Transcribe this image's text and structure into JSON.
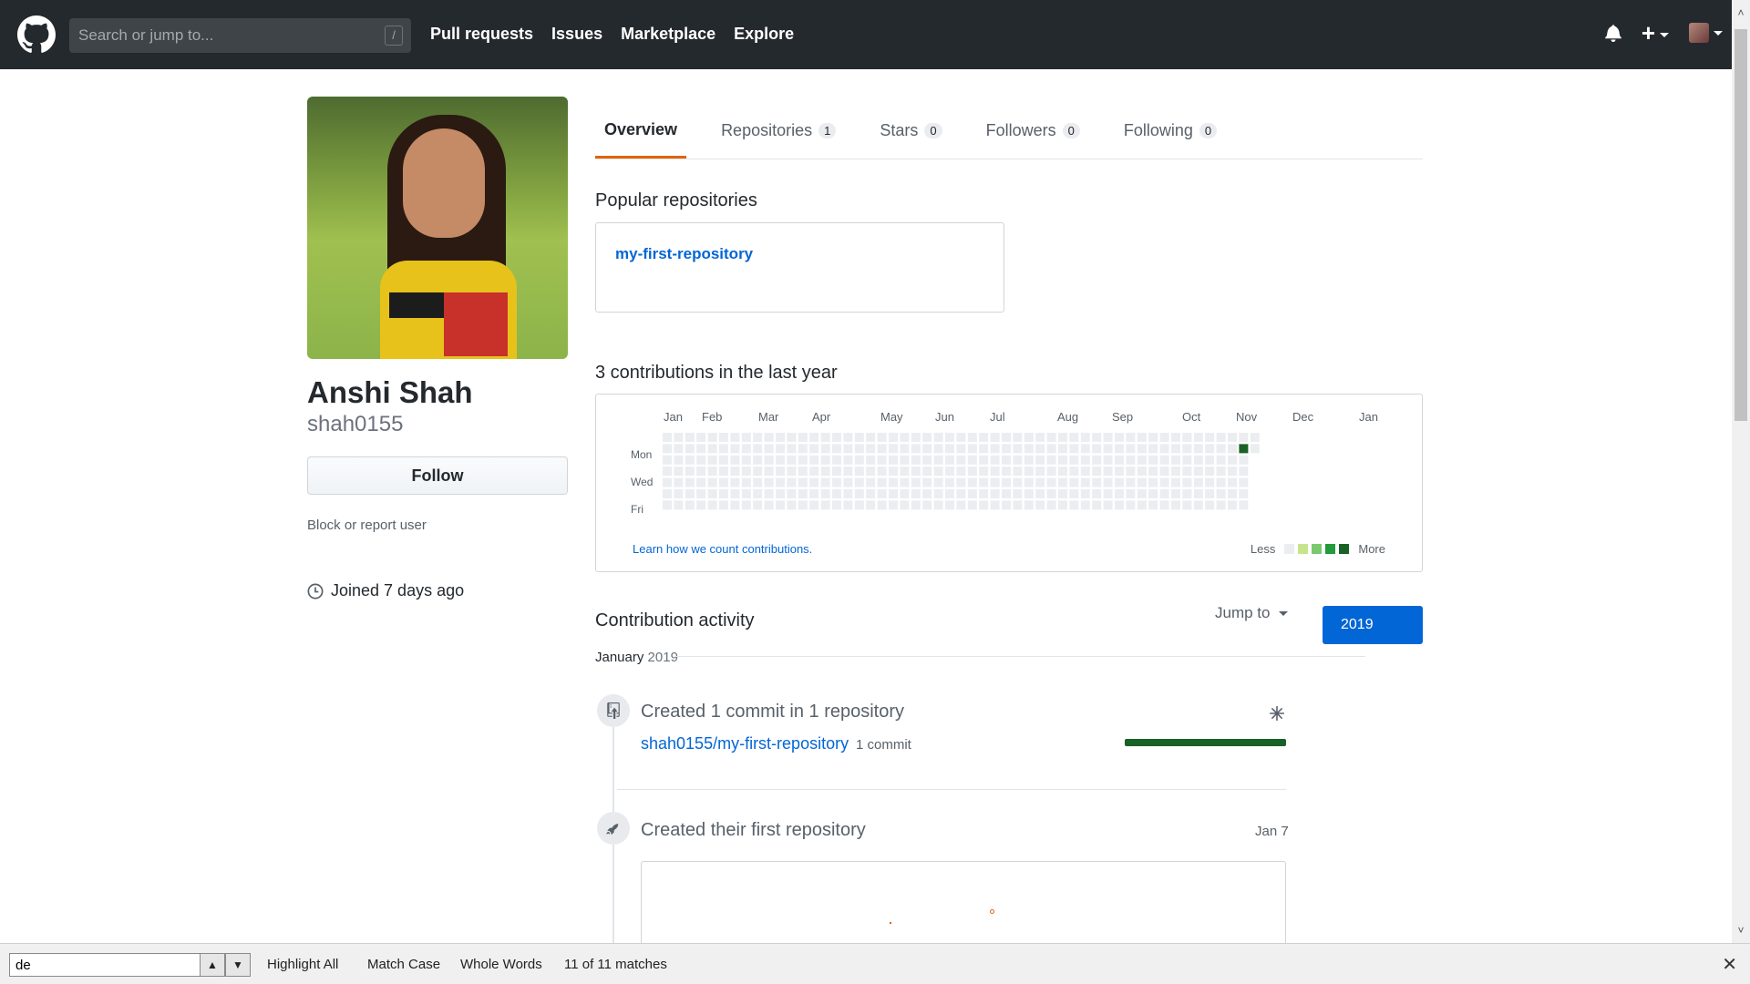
{
  "header": {
    "search_placeholder": "Search or jump to...",
    "slash": "/",
    "nav": [
      "Pull requests",
      "Issues",
      "Marketplace",
      "Explore"
    ]
  },
  "profile": {
    "name": "Anshi Shah",
    "login": "shah0155",
    "follow_label": "Follow",
    "block_label": "Block or report user",
    "joined": "Joined 7 days ago"
  },
  "tabs": [
    {
      "label": "Overview",
      "count": null,
      "active": true
    },
    {
      "label": "Repositories",
      "count": "1",
      "active": false
    },
    {
      "label": "Stars",
      "count": "0",
      "active": false
    },
    {
      "label": "Followers",
      "count": "0",
      "active": false
    },
    {
      "label": "Following",
      "count": "0",
      "active": false
    }
  ],
  "popular": {
    "title": "Popular repositories",
    "repo": "my-first-repository"
  },
  "contributions": {
    "title": "3 contributions in the last year",
    "months": [
      "Jan",
      "Feb",
      "Mar",
      "Apr",
      "May",
      "Jun",
      "Jul",
      "Aug",
      "Sep",
      "Oct",
      "Nov",
      "Dec",
      "Jan"
    ],
    "days": [
      "Mon",
      "Wed",
      "Fri"
    ],
    "learn": "Learn how we count contributions.",
    "less": "Less",
    "more": "More",
    "legend_colors": [
      "#ebedf0",
      "#c6e48b",
      "#7bc96f",
      "#239a3b",
      "#196127"
    ]
  },
  "activity": {
    "title": "Contribution activity",
    "jump_to": "Jump to",
    "year": "2019",
    "month": "January",
    "month_year": "2019",
    "commit_title": "Created 1 commit in 1 repository",
    "commit_repo": "shah0155/my-first-repository",
    "commit_count": "1 commit",
    "first_repo_title": "Created their first repository",
    "first_repo_date": "Jan 7"
  },
  "findbar": {
    "query": "de",
    "highlight_all": "Highlight All",
    "match_case": "Match Case",
    "whole_words": "Whole Words",
    "matches": "11 of 11 matches"
  }
}
